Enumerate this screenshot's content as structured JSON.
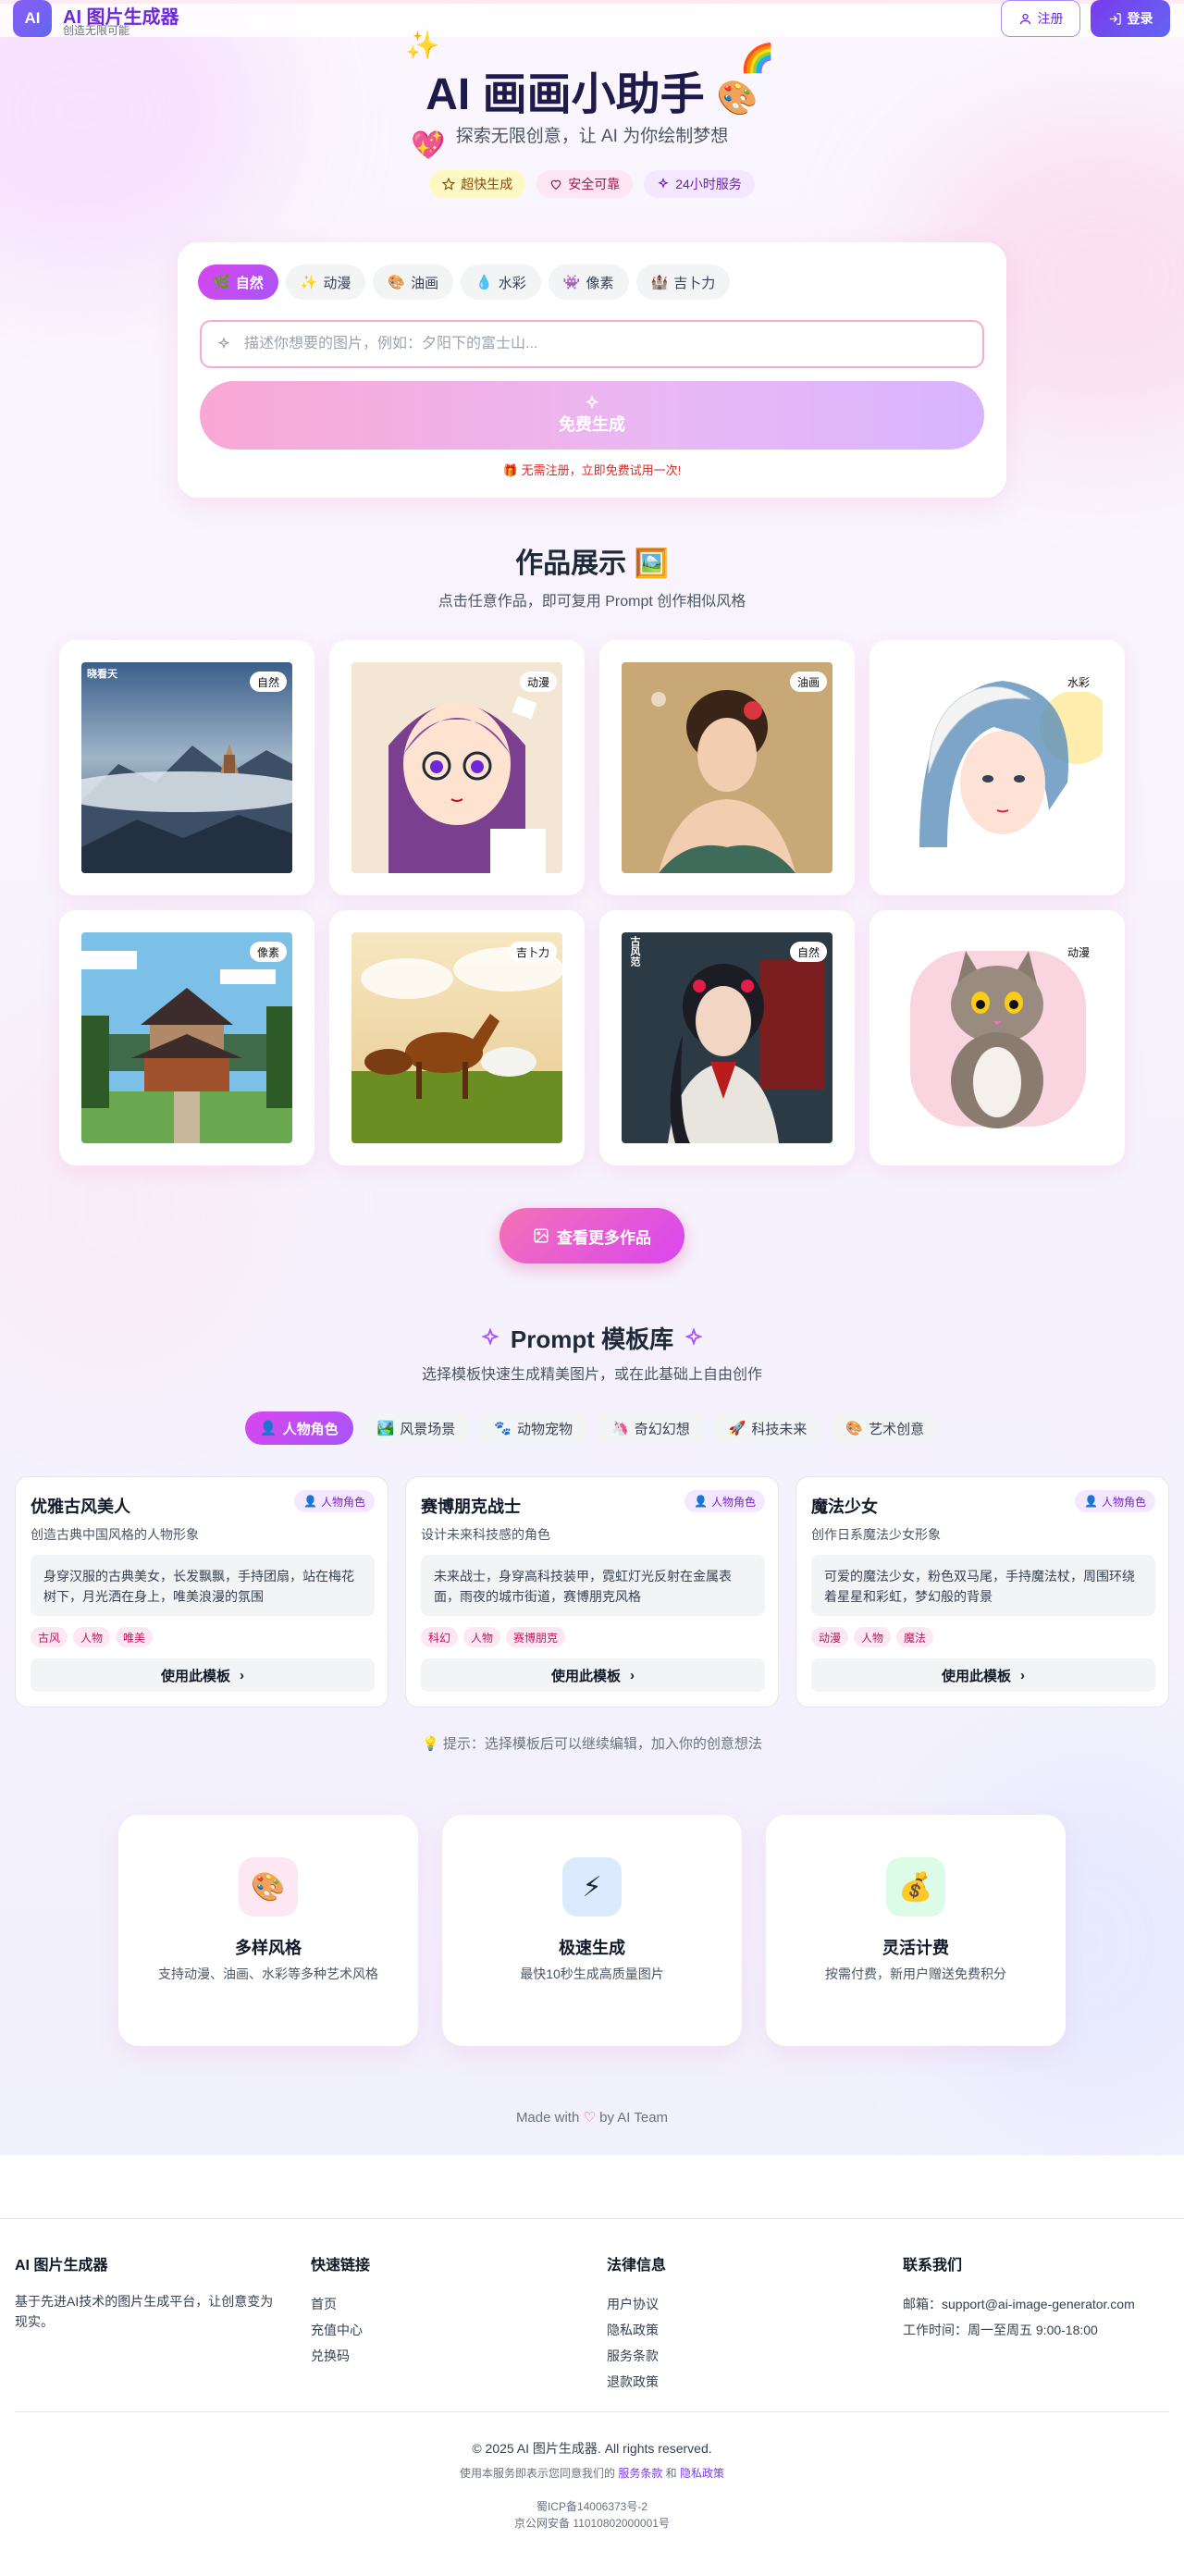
{
  "header": {
    "logo_text": "AI",
    "brand": "AI 图片生成器",
    "brand_sub": "创造无限可能",
    "register_label": "注册",
    "login_label": "登录"
  },
  "hero": {
    "title": "AI 画画小助手",
    "subtitle": "探索无限创意，让 AI 为你绘制梦想",
    "badges": [
      "超快生成",
      "安全可靠",
      "24小时服务"
    ]
  },
  "generator": {
    "styles": [
      {
        "icon": "🌿",
        "label": "自然"
      },
      {
        "icon": "✨",
        "label": "动漫"
      },
      {
        "icon": "🎨",
        "label": "油画"
      },
      {
        "icon": "💧",
        "label": "水彩"
      },
      {
        "icon": "👾",
        "label": "像素"
      },
      {
        "icon": "🏰",
        "label": "吉卜力"
      }
    ],
    "active_style": "自然",
    "prompt_placeholder": "描述你想要的图片，例如：夕阳下的富士山...",
    "prompt_value": "",
    "generate_label": "免费生成",
    "free_note": "🎁 无需注册，立即免费试用一次!"
  },
  "showcase": {
    "title": "作品展示 🖼️",
    "subtitle": "点击任意作品，即可复用 Prompt 创作相似风格",
    "items": [
      {
        "tag": "自然",
        "image": "misty-mountain-temple",
        "stamp": "晓看天"
      },
      {
        "tag": "动漫",
        "image": "anime-girl-glasses"
      },
      {
        "tag": "油画",
        "image": "oil-painting-woman"
      },
      {
        "tag": "水彩",
        "image": "watercolor-girl"
      },
      {
        "tag": "像素",
        "image": "pixel-temple"
      },
      {
        "tag": "吉卜力",
        "image": "ghibli-horses"
      },
      {
        "tag": "自然",
        "image": "hanfu-woman",
        "stamp": "古风范"
      },
      {
        "tag": "动漫",
        "image": "cartoon-cat"
      }
    ],
    "more_label": "查看更多作品"
  },
  "templates": {
    "title": "Prompt 模板库",
    "subtitle": "选择模板快速生成精美图片，或在此基础上自由创作",
    "categories": [
      {
        "icon": "👤",
        "label": "人物角色"
      },
      {
        "icon": "🏞️",
        "label": "风景场景"
      },
      {
        "icon": "🐾",
        "label": "动物宠物"
      },
      {
        "icon": "🦄",
        "label": "奇幻幻想"
      },
      {
        "icon": "🚀",
        "label": "科技未来"
      },
      {
        "icon": "🎨",
        "label": "艺术创意"
      }
    ],
    "active_category": "人物角色",
    "cards": [
      {
        "title": "优雅古风美人",
        "badge": "人物角色",
        "desc": "创造古典中国风格的人物形象",
        "prompt": "身穿汉服的古典美女，长发飘飘，手持团扇，站在梅花树下，月光洒在身上，唯美浪漫的氛围",
        "tags": [
          "古风",
          "人物",
          "唯美"
        ],
        "use_label": "使用此模板"
      },
      {
        "title": "赛博朋克战士",
        "badge": "人物角色",
        "desc": "设计未来科技感的角色",
        "prompt": "未来战士，身穿高科技装甲，霓虹灯光反射在金属表面，雨夜的城市街道，赛博朋克风格",
        "tags": [
          "科幻",
          "人物",
          "赛博朋克"
        ],
        "use_label": "使用此模板"
      },
      {
        "title": "魔法少女",
        "badge": "人物角色",
        "desc": "创作日系魔法少女形象",
        "prompt": "可爱的魔法少女，粉色双马尾，手持魔法杖，周围环绕着星星和彩虹，梦幻般的背景",
        "tags": [
          "动漫",
          "人物",
          "魔法"
        ],
        "use_label": "使用此模板"
      }
    ],
    "tip": "💡 提示：选择模板后可以继续编辑，加入你的创意想法"
  },
  "features": [
    {
      "icon": "🎨",
      "title": "多样风格",
      "desc": "支持动漫、油画、水彩等多种艺术风格",
      "bg": "#fce7f3"
    },
    {
      "icon": "⚡",
      "title": "极速生成",
      "desc": "最快10秒生成高质量图片",
      "bg": "#dbeafe"
    },
    {
      "icon": "💰",
      "title": "灵活计费",
      "desc": "按需付费，新用户赠送免费积分",
      "bg": "#dcfce7"
    }
  ],
  "made_with": {
    "prefix": "Made with",
    "suffix": "by AI Team"
  },
  "footer": {
    "about": {
      "title": "AI 图片生成器",
      "desc": "基于先进AI技术的图片生成平台，让创意变为现实。"
    },
    "quick": {
      "title": "快速链接",
      "links": [
        "首页",
        "充值中心",
        "兑换码"
      ]
    },
    "legal": {
      "title": "法律信息",
      "links": [
        "用户协议",
        "隐私政策",
        "服务条款",
        "退款政策"
      ]
    },
    "contact": {
      "title": "联系我们",
      "email": "邮箱：support@ai-image-generator.com",
      "hours": "工作时间：周一至周五 9:00-18:00"
    },
    "copyright": "© 2025 AI 图片生成器. All rights reserved.",
    "terms_prefix": "使用本服务即表示您同意我们的",
    "terms_link": "服务条款",
    "terms_and": "和",
    "privacy_link": "隐私政策",
    "icp": "蜀ICP备14006373号-2",
    "police": "京公网安备 11010802000001号"
  },
  "colors": {
    "accent": "#a855f7",
    "pink": "#ec4899",
    "brand": "#6d28d9"
  }
}
